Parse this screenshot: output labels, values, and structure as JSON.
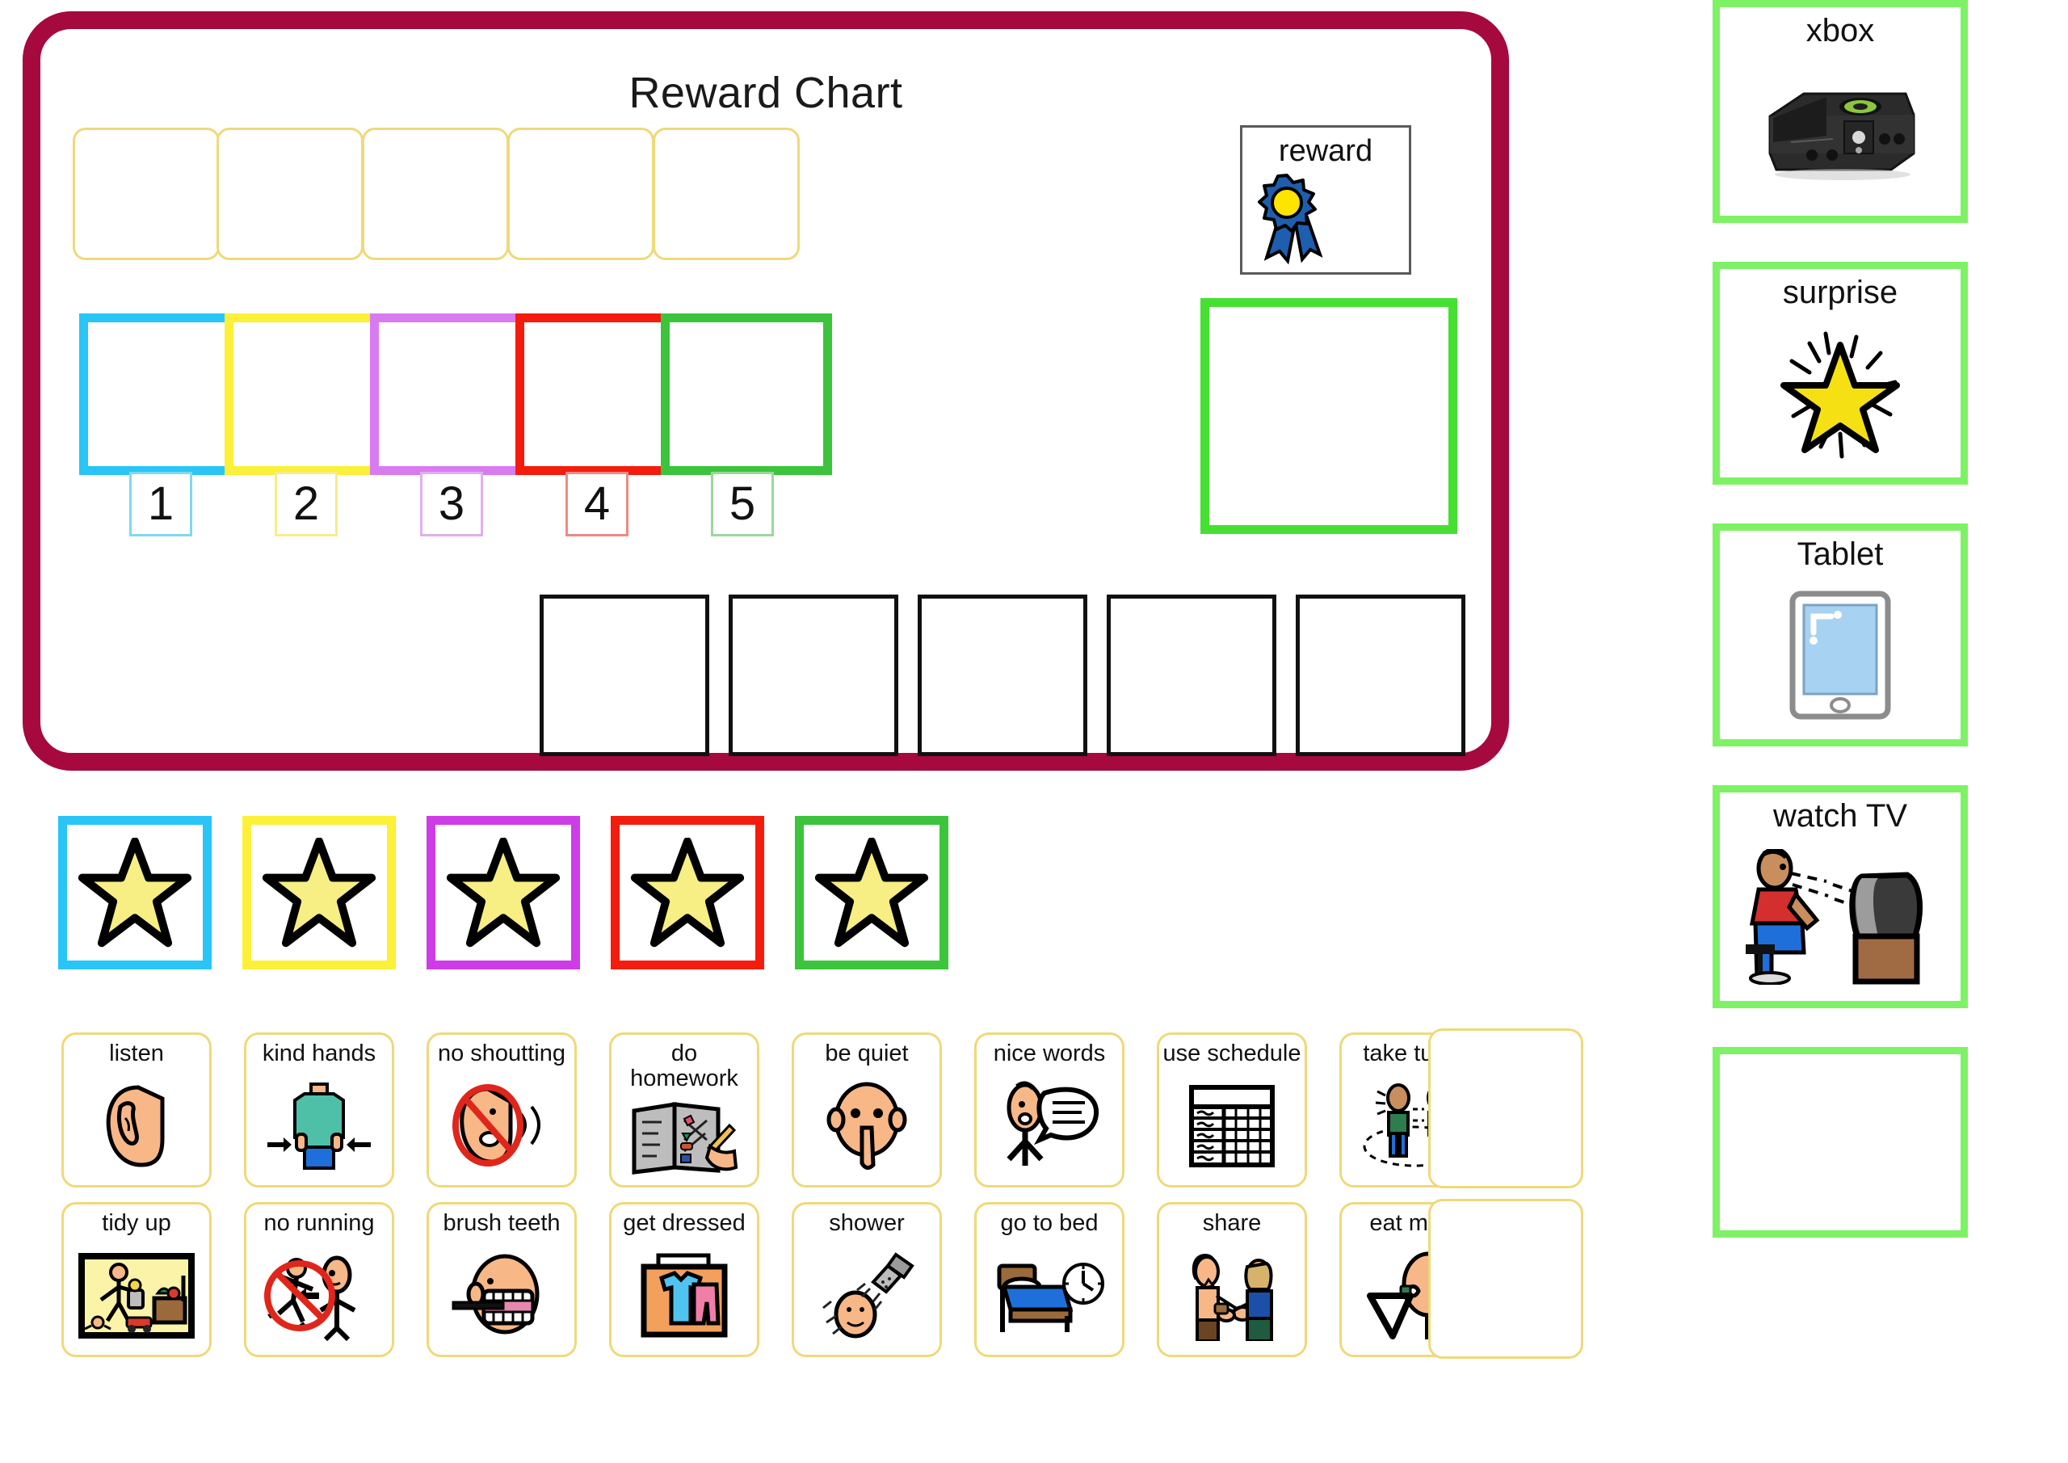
{
  "chart": {
    "title": "Reward Chart",
    "reward_card": {
      "label": "reward",
      "icon": "rosette-ribbon-icon"
    },
    "top_slots": [
      {
        "id": "top-slot-1",
        "label": ""
      },
      {
        "id": "top-slot-2",
        "label": ""
      },
      {
        "id": "top-slot-3",
        "label": ""
      },
      {
        "id": "top-slot-4",
        "label": ""
      },
      {
        "id": "top-slot-5",
        "label": ""
      }
    ],
    "columns": [
      {
        "number": "1",
        "color": "#29C5F6"
      },
      {
        "number": "2",
        "color": "#FCF039"
      },
      {
        "number": "3",
        "color": "#D97BF0"
      },
      {
        "number": "4",
        "color": "#F41C0C"
      },
      {
        "number": "5",
        "color": "#3CC43C"
      }
    ],
    "goal_box": {
      "color": "#46E033",
      "label": ""
    },
    "token_boxes": [
      {
        "label": ""
      },
      {
        "label": ""
      },
      {
        "label": ""
      },
      {
        "label": ""
      },
      {
        "label": ""
      }
    ]
  },
  "star_strip": [
    {
      "border_color": "#29C5F6",
      "icon": "star-icon"
    },
    {
      "border_color": "#FCF039",
      "icon": "star-icon"
    },
    {
      "border_color": "#CE3CE8",
      "icon": "star-icon"
    },
    {
      "border_color": "#F41C0C",
      "icon": "star-icon"
    },
    {
      "border_color": "#3CC43C",
      "icon": "star-icon"
    }
  ],
  "activities": {
    "row1": [
      {
        "label": "listen",
        "icon": "ear-listen-icon"
      },
      {
        "label": "kind hands",
        "icon": "kind-hands-icon"
      },
      {
        "label": "no shoutting",
        "icon": "no-shouting-icon"
      },
      {
        "label": "do homework",
        "icon": "homework-book-icon"
      },
      {
        "label": "be quiet",
        "icon": "quiet-face-icon"
      },
      {
        "label": "nice words",
        "icon": "nice-words-icon"
      },
      {
        "label": "use schedule",
        "icon": "schedule-grid-icon"
      },
      {
        "label": "take turns",
        "icon": "take-turns-icon"
      },
      {
        "label": "",
        "icon": ""
      }
    ],
    "row2": [
      {
        "label": "tidy up",
        "icon": "tidy-up-icon"
      },
      {
        "label": "no running",
        "icon": "no-running-icon"
      },
      {
        "label": "brush teeth",
        "icon": "brush-teeth-icon"
      },
      {
        "label": "get dressed",
        "icon": "get-dressed-icon"
      },
      {
        "label": "shower",
        "icon": "shower-icon"
      },
      {
        "label": "go to bed",
        "icon": "bed-clock-icon"
      },
      {
        "label": "share",
        "icon": "share-icon"
      },
      {
        "label": "eat meal",
        "icon": "eat-meal-icon"
      },
      {
        "label": "",
        "icon": ""
      }
    ]
  },
  "sidebar": [
    {
      "label": "xbox",
      "icon": "xbox-console-icon"
    },
    {
      "label": "surprise",
      "icon": "sparkle-star-icon"
    },
    {
      "label": "Tablet",
      "icon": "tablet-device-icon"
    },
    {
      "label": "watch TV",
      "icon": "watch-tv-icon"
    },
    {
      "label": "",
      "icon": ""
    }
  ],
  "colors": {
    "panel_border": "#A6093D",
    "slot_outline": "#EFD97A",
    "sidebar_border": "#7DF264",
    "star_fill": "#F7EE84",
    "goal_green": "#46E033"
  }
}
